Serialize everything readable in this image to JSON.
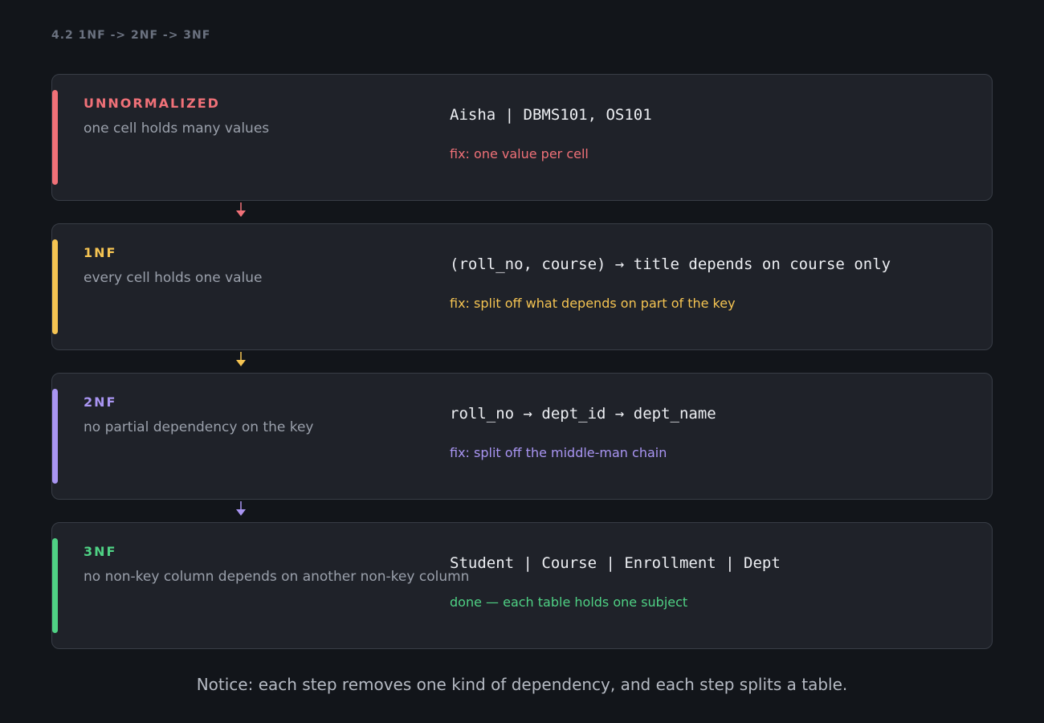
{
  "section_label": "4.2  1NF -> 2NF -> 3NF",
  "colors": {
    "background": "#12151a",
    "card": "#1f2229",
    "card_border": "#383d46",
    "unnormalized": "#f07178",
    "one_nf": "#f5c452",
    "two_nf": "#a995f2",
    "three_nf": "#4fd184"
  },
  "stages": [
    {
      "name": "UNNORMALIZED",
      "description": "one cell holds many values",
      "example": "Aisha | DBMS101, OS101",
      "fix": "fix: one value per cell",
      "color": "#f07178"
    },
    {
      "name": "1NF",
      "description": "every cell holds one value",
      "example": "(roll_no, course) → title depends on course only",
      "fix": "fix: split off what depends on part of the key",
      "color": "#f5c452"
    },
    {
      "name": "2NF",
      "description": "no partial dependency on the key",
      "example": "roll_no → dept_id → dept_name",
      "fix": "fix: split off the middle-man chain",
      "color": "#a995f2"
    },
    {
      "name": "3NF",
      "description": "no non-key column depends on another non-key column",
      "example": "Student | Course | Enrollment | Dept",
      "fix": "done — each table holds one subject",
      "color": "#4fd184"
    }
  ],
  "connectors": [
    {
      "color": "#f07178",
      "icon": "arrow-down-icon"
    },
    {
      "color": "#f5c452",
      "icon": "arrow-down-icon"
    },
    {
      "color": "#a995f2",
      "icon": "arrow-down-icon"
    }
  ],
  "footer_note": "Notice: each step removes one kind of dependency, and each step splits a table."
}
